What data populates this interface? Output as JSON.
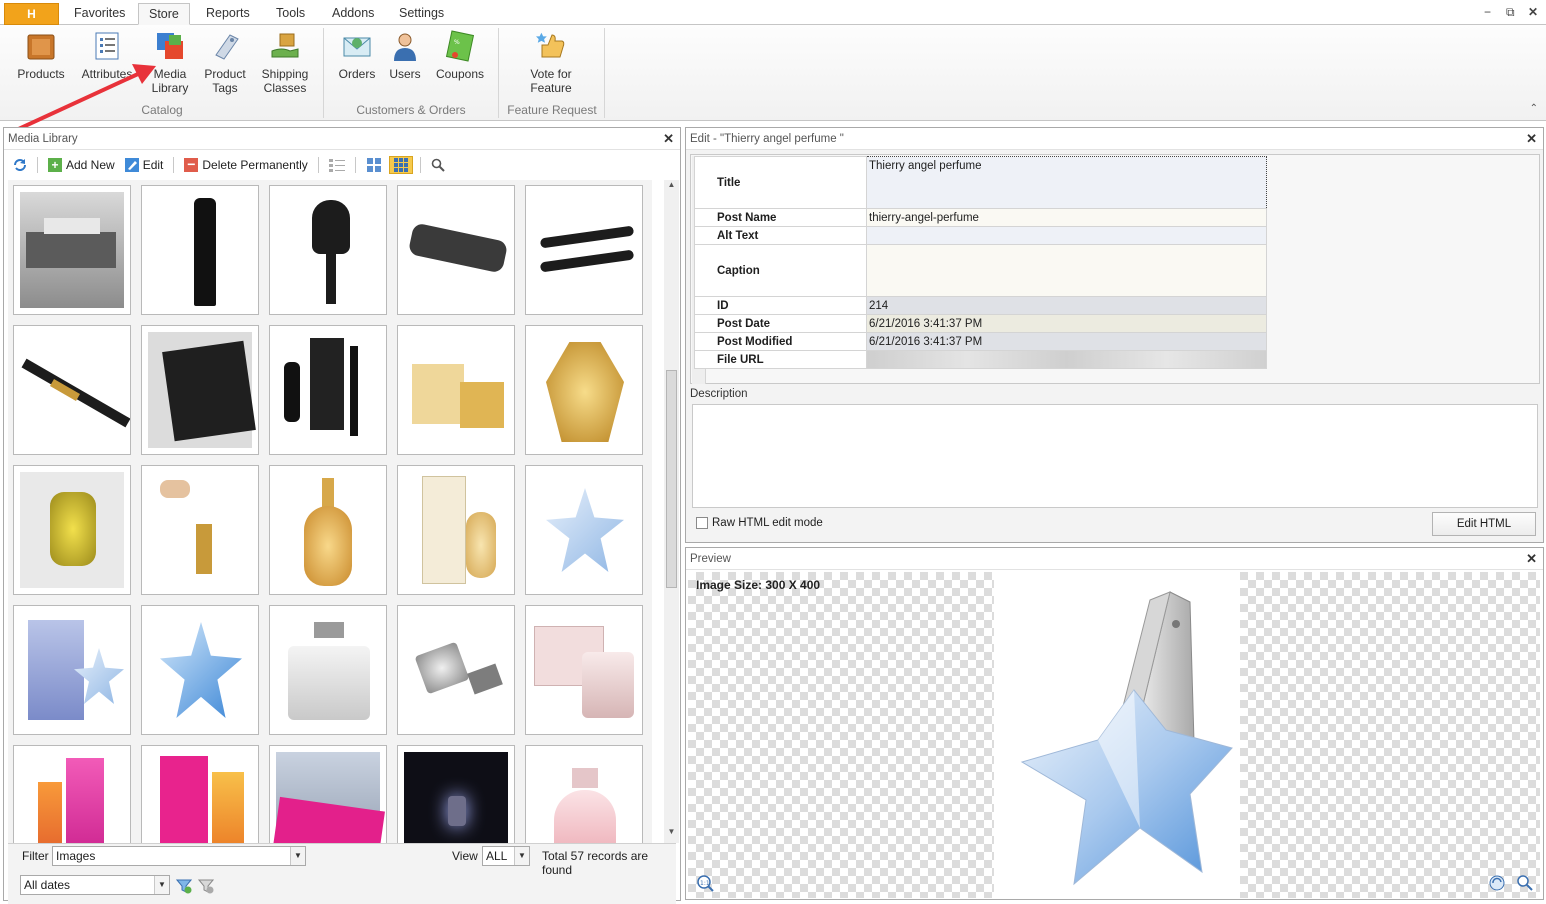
{
  "app_button_label": "H",
  "tabs": [
    "Favorites",
    "Store",
    "Reports",
    "Tools",
    "Addons",
    "Settings"
  ],
  "ribbon": {
    "catalog": {
      "label": "Catalog",
      "products": "Products",
      "attributes": "Attributes",
      "media_library": [
        "Media",
        "Library"
      ],
      "product_tags": [
        "Product",
        "Tags"
      ],
      "shipping_classes": [
        "Shipping",
        "Classes"
      ]
    },
    "customers": {
      "label": "Customers & Orders",
      "orders": "Orders",
      "users": "Users",
      "coupons": "Coupons"
    },
    "feature": {
      "label": "Feature Request",
      "vote": [
        "Vote for",
        "Feature"
      ]
    }
  },
  "media_panel": {
    "title": "Media Library",
    "toolbar": {
      "add_new": "Add New",
      "edit": "Edit",
      "delete": "Delete Permanently"
    },
    "filter_label": "Filter",
    "filter_value": "Images",
    "view_label": "View",
    "view_value": "ALL",
    "total": "Total 57 records are found",
    "dates_value": "All dates"
  },
  "edit_panel": {
    "title": "Edit - \"Thierry angel perfume \"",
    "fields": {
      "title_label": "Title",
      "title_value": "Thierry angel perfume",
      "post_name_label": "Post Name",
      "post_name_value": "thierry-angel-perfume",
      "alt_text_label": "Alt Text",
      "alt_text_value": "",
      "caption_label": "Caption",
      "caption_value": "",
      "id_label": "ID",
      "id_value": "214",
      "post_date_label": "Post Date",
      "post_date_value": "6/21/2016 3:41:37 PM",
      "post_modified_label": "Post Modified",
      "post_modified_value": "6/21/2016 3:41:37 PM",
      "file_url_label": "File URL"
    },
    "description_label": "Description",
    "raw_html_label": "Raw HTML edit mode",
    "raw_html_checked": false,
    "edit_html_button": "Edit HTML"
  },
  "preview_panel": {
    "title": "Preview",
    "image_size": "Image Size: 300 X 400"
  },
  "accent_colors": {
    "app_button": "#f2a31b",
    "arrow": "#e8323a",
    "selected_view": "#f6c94c"
  }
}
